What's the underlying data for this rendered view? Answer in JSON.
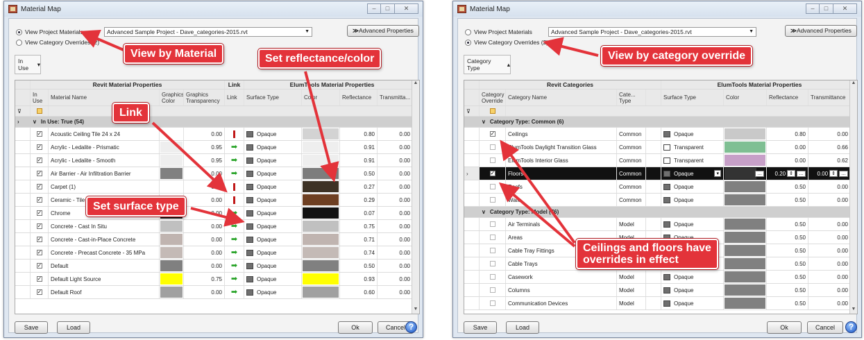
{
  "left": {
    "title": "Material Map",
    "radio1": "View Project Materials",
    "radio2": "View Category Overrides (2)",
    "project": "Advanced Sample Project - Dave_categories-2015.rvt",
    "adv": "Advanced Properties",
    "inuse": "In Use",
    "hdr_revit": "Revit Material Properties",
    "hdr_link": "Link",
    "hdr_elum": "ElumTools Material Properties",
    "cols": {
      "inuse": "In Use",
      "name": "Material Name",
      "gcolor": "Graphics Color",
      "gtrans": "Graphics Transparency",
      "link": "Link",
      "stype": "Surface Type",
      "color": "Color",
      "refl": "Reflectance",
      "trans": "Transmitta..."
    },
    "group": "In Use: True  (54)",
    "rows": [
      {
        "name": "Acoustic Ceiling Tile 24 x 24",
        "gcolor": "#ffffff",
        "gtrans": "0.00",
        "link": "red",
        "stype": "Opaque",
        "color": "#d3d3d3",
        "refl": "0.80",
        "trans": "0.00"
      },
      {
        "name": "Acrylic - Ledalite - Prismatic",
        "gcolor": "#eeeeee",
        "gtrans": "0.95",
        "link": "green",
        "stype": "Opaque",
        "color": "#eeeeee",
        "refl": "0.91",
        "trans": "0.00"
      },
      {
        "name": "Acrylic - Ledalite - Smooth",
        "gcolor": "#eeeeee",
        "gtrans": "0.95",
        "link": "green",
        "stype": "Opaque",
        "color": "#eeeeee",
        "refl": "0.91",
        "trans": "0.00"
      },
      {
        "name": "Air Barrier - Air Infiltration Barrier",
        "gcolor": "#808080",
        "gtrans": "0.00",
        "link": "green",
        "stype": "Opaque",
        "color": "#7d7d7d",
        "refl": "0.50",
        "trans": "0.00"
      },
      {
        "name": "Carpet (1)",
        "gcolor": "#ffffff",
        "gtrans": "0.00",
        "link": "red",
        "stype": "Opaque",
        "color": "#3d3225",
        "refl": "0.27",
        "trans": "0.00"
      },
      {
        "name": "Ceramic - Tile",
        "gcolor": "#ffffff",
        "gtrans": "0.00",
        "link": "red",
        "stype": "Opaque",
        "color": "#6e3f22",
        "refl": "0.29",
        "trans": "0.00"
      },
      {
        "name": "Chrome",
        "gcolor": "#111111",
        "gtrans": "0.00",
        "link": "green",
        "stype": "Opaque",
        "color": "#121212",
        "refl": "0.07",
        "trans": "0.00"
      },
      {
        "name": "Concrete - Cast In Situ",
        "gcolor": "#c0c0c0",
        "gtrans": "0.00",
        "link": "green",
        "stype": "Opaque",
        "color": "#c0c0c0",
        "refl": "0.75",
        "trans": "0.00"
      },
      {
        "name": "Concrete - Cast-in-Place Concrete",
        "gcolor": "#c0b4b0",
        "gtrans": "0.00",
        "link": "green",
        "stype": "Opaque",
        "color": "#c0b4b0",
        "refl": "0.71",
        "trans": "0.00"
      },
      {
        "name": "Concrete - Precast Concrete - 35 MPa",
        "gcolor": "#c4bab6",
        "gtrans": "0.00",
        "link": "green",
        "stype": "Opaque",
        "color": "#c4bab6",
        "refl": "0.74",
        "trans": "0.00"
      },
      {
        "name": "Default",
        "gcolor": "#808080",
        "gtrans": "0.00",
        "link": "green",
        "stype": "Opaque",
        "color": "#808080",
        "refl": "0.50",
        "trans": "0.00"
      },
      {
        "name": "Default Light Source",
        "gcolor": "#ffff00",
        "gtrans": "0.75",
        "link": "green",
        "stype": "Opaque",
        "color": "#ffff00",
        "refl": "0.93",
        "trans": "0.00"
      },
      {
        "name": "Default Roof",
        "gcolor": "#a0a0a0",
        "gtrans": "0.00",
        "link": "green",
        "stype": "Opaque",
        "color": "#a0a0a0",
        "refl": "0.60",
        "trans": "0.00"
      }
    ],
    "save": "Save",
    "load": "Load",
    "ok": "Ok",
    "cancel": "Cancel"
  },
  "right": {
    "title": "Material Map",
    "radio1": "View Project Materials",
    "radio2": "View Category Overrides (2)",
    "project": "Advanced Sample Project - Dave_categories-2015.rvt",
    "adv": "Advanced Properties",
    "cattype": "Category Type",
    "hdr_revit": "Revit Categories",
    "hdr_elum": "ElumTools Material Properties",
    "cols": {
      "override": "Category Override",
      "name": "Category Name",
      "ctype": "Cate... Type",
      "stype": "Surface Type",
      "color": "Color",
      "refl": "Reflectance",
      "trans": "Transmittance"
    },
    "group1": "Category Type: Common  (6)",
    "group2": "Category Type: Model  (76)",
    "rows1": [
      {
        "checked": true,
        "name": "Ceilings",
        "ctype": "Common",
        "stype": "Opaque",
        "color": "#c9c9c9",
        "refl": "0.80",
        "trans": "0.00"
      },
      {
        "checked": false,
        "name": "ElumTools Daylight Transition Glass",
        "ctype": "Common",
        "stype": "Transparent",
        "color": "#7fbf93",
        "refl": "0.00",
        "trans": "0.66"
      },
      {
        "checked": false,
        "name": "ElumTools Interior Glass",
        "ctype": "Common",
        "stype": "Transparent",
        "color": "#c7a0c8",
        "refl": "0.00",
        "trans": "0.62"
      },
      {
        "checked": true,
        "name": "Floors",
        "ctype": "Common",
        "stype": "Opaque",
        "color": "#333333",
        "refl": "0.20",
        "trans": "0.00",
        "selected": true
      },
      {
        "checked": false,
        "name": "Roofs",
        "ctype": "Common",
        "stype": "Opaque",
        "color": "#808080",
        "refl": "0.50",
        "trans": "0.00"
      },
      {
        "checked": false,
        "name": "Walls",
        "ctype": "Common",
        "stype": "Opaque",
        "color": "#808080",
        "refl": "0.50",
        "trans": "0.00"
      }
    ],
    "rows2": [
      {
        "name": "Air Terminals",
        "ctype": "Model",
        "stype": "Opaque",
        "color": "#808080",
        "refl": "0.50",
        "trans": "0.00"
      },
      {
        "name": "Areas",
        "ctype": "Model",
        "stype": "Opaque",
        "color": "#808080",
        "refl": "0.50",
        "trans": "0.00"
      },
      {
        "name": "Cable Tray Fittings",
        "ctype": "Model",
        "stype": "Opaque",
        "color": "#808080",
        "refl": "0.50",
        "trans": "0.00"
      },
      {
        "name": "Cable Trays",
        "ctype": "Model",
        "stype": "Opaque",
        "color": "#808080",
        "refl": "0.50",
        "trans": "0.00"
      },
      {
        "name": "Casework",
        "ctype": "Model",
        "stype": "Opaque",
        "color": "#808080",
        "refl": "0.50",
        "trans": "0.00"
      },
      {
        "name": "Columns",
        "ctype": "Model",
        "stype": "Opaque",
        "color": "#808080",
        "refl": "0.50",
        "trans": "0.00"
      },
      {
        "name": "Communication Devices",
        "ctype": "Model",
        "stype": "Opaque",
        "color": "#808080",
        "refl": "0.50",
        "trans": "0.00"
      }
    ],
    "save": "Save",
    "load": "Load",
    "ok": "Ok",
    "cancel": "Cancel"
  },
  "annotations": {
    "view_material": "View by Material",
    "set_refl": "Set reflectance/color",
    "link": "Link",
    "set_surface": "Set surface type",
    "view_category": "View by category override",
    "ceilings_line1": "Ceilings and floors have",
    "ceilings_line2": "overrides in effect"
  },
  "colors": {
    "annotation": "#e3333a",
    "selected_row": "#111111",
    "link_red": "#c01818",
    "link_green": "#23a123"
  }
}
